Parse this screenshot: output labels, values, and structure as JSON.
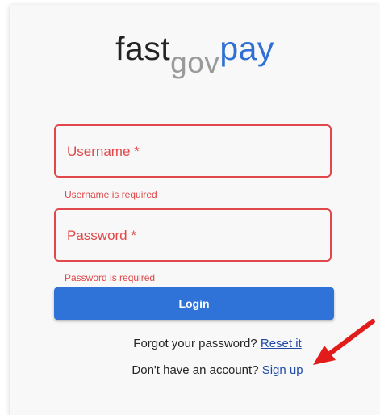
{
  "logo": {
    "part1": "fast",
    "part2": "gov",
    "part3": "pay"
  },
  "form": {
    "username": {
      "label": "Username *",
      "helper": "Username is required"
    },
    "password": {
      "label": "Password *",
      "helper": "Password is required"
    },
    "login_label": "Login"
  },
  "links": {
    "forgot_text": "Forgot your password?",
    "forgot_link": "Reset it",
    "signup_text": "Don't have an account?",
    "signup_link": "Sign up"
  },
  "colors": {
    "error": "#e14749",
    "primary": "#2f72d8",
    "link": "#1f4aa8",
    "arrow": "#e21b1b"
  },
  "annotation": {
    "arrow_icon": "red-arrow-icon"
  }
}
